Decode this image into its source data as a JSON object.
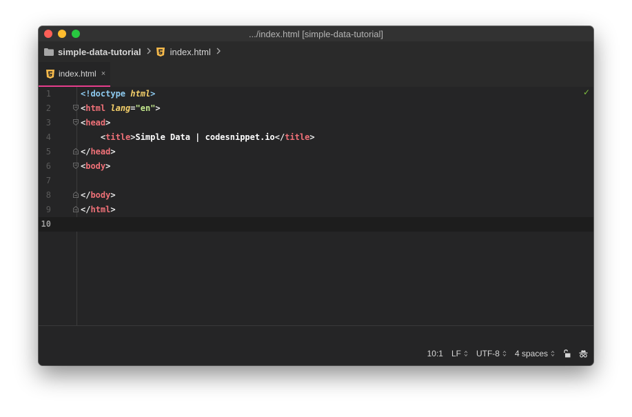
{
  "window": {
    "title": ".../index.html [simple-data-tutorial]"
  },
  "breadcrumb": {
    "folder": "simple-data-tutorial",
    "file": "index.html",
    "folder_icon": "folder-icon",
    "file_icon": "html5-icon",
    "chevron": ">"
  },
  "tabs": [
    {
      "label": "index.html",
      "close": "×",
      "icon": "html5-icon",
      "active": true
    }
  ],
  "editor": {
    "lines": [
      {
        "number": "1"
      },
      {
        "number": "2"
      },
      {
        "number": "3"
      },
      {
        "number": "4"
      },
      {
        "number": "5"
      },
      {
        "number": "6"
      },
      {
        "number": "7"
      },
      {
        "number": "8"
      },
      {
        "number": "9"
      },
      {
        "number": "10"
      }
    ],
    "tokens": {
      "l1": [
        "<!",
        "doctype",
        " ",
        "html",
        ">"
      ],
      "l2": [
        "<",
        "html",
        " ",
        "lang",
        "=",
        "\"en\"",
        ">"
      ],
      "l3": [
        "<",
        "head",
        ">"
      ],
      "l4": [
        "    <",
        "title",
        ">",
        "Simple Data | codesnippet.io",
        "</",
        "title",
        ">"
      ],
      "l5": [
        "</",
        "head",
        ">"
      ],
      "l6": [
        "<",
        "body",
        ">"
      ],
      "l8": [
        "</",
        "body",
        ">"
      ],
      "l9": [
        "</",
        "html",
        ">"
      ]
    },
    "status_check": "✓",
    "accent_color": "#e83e8c"
  },
  "statusbar": {
    "cursor": "10:1",
    "line_ending": "LF",
    "encoding": "UTF-8",
    "indentation": "4 spaces",
    "updown": "⌃⌄",
    "lock_icon": "unlock-icon",
    "spy_icon": "incognito-icon"
  }
}
